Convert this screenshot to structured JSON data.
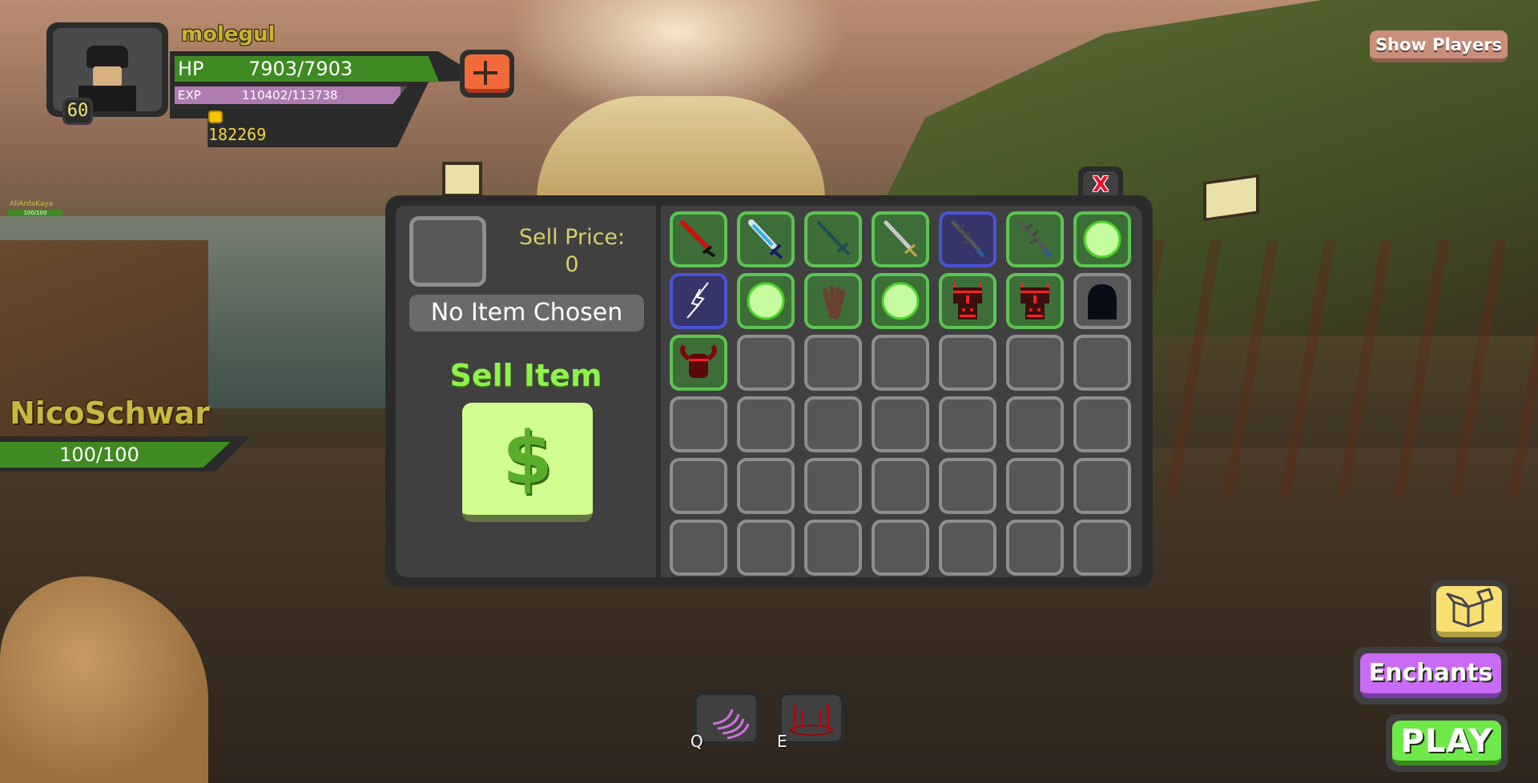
{
  "player": {
    "username": "molegul",
    "level": "60",
    "hp_label": "HP",
    "hp_text": "7903/7903",
    "hp_fraction": 1.0,
    "exp_label": "EXP",
    "exp_text": "110402/113738",
    "exp_fraction": 0.9707,
    "coins": "182269",
    "add_button_icon": "plus-icon"
  },
  "other_players": [
    {
      "name": "AliArdaKaya",
      "hp_text": "100/100"
    }
  ],
  "npc": {
    "name": "NicoSchwar",
    "hp_text": "100/100"
  },
  "top_right": {
    "show_players_label": "Show Players"
  },
  "sell_panel": {
    "close_label": "X",
    "sell_price_label": "Sell Price:",
    "sell_price_value": "0",
    "selected_item_name": "No Item Chosen",
    "sell_item_label": "Sell Item",
    "sell_button_icon": "dollar-icon",
    "inventory": [
      {
        "icon": "red-sword-icon",
        "rarity": "common"
      },
      {
        "icon": "ice-sword-icon",
        "rarity": "common"
      },
      {
        "icon": "teal-sword-icon",
        "rarity": "common"
      },
      {
        "icon": "silver-sword-icon",
        "rarity": "common"
      },
      {
        "icon": "dark-thorn-sword-icon",
        "rarity": "rare"
      },
      {
        "icon": "dark-thorn-sword-icon",
        "rarity": "common"
      },
      {
        "icon": "green-orb-icon",
        "rarity": "common"
      },
      {
        "icon": "lightning-icon",
        "rarity": "rare"
      },
      {
        "icon": "green-orb-icon",
        "rarity": "common"
      },
      {
        "icon": "wood-bundle-icon",
        "rarity": "common"
      },
      {
        "icon": "green-orb-icon",
        "rarity": "common"
      },
      {
        "icon": "red-armor-icon",
        "rarity": "common"
      },
      {
        "icon": "red-armor-icon",
        "rarity": "common"
      },
      {
        "icon": "dark-hood-icon",
        "rarity": "none"
      },
      {
        "icon": "horned-helmet-icon",
        "rarity": "common"
      },
      {
        "icon": "",
        "rarity": "empty"
      },
      {
        "icon": "",
        "rarity": "empty"
      },
      {
        "icon": "",
        "rarity": "empty"
      },
      {
        "icon": "",
        "rarity": "empty"
      },
      {
        "icon": "",
        "rarity": "empty"
      },
      {
        "icon": "",
        "rarity": "empty"
      },
      {
        "icon": "",
        "rarity": "empty"
      },
      {
        "icon": "",
        "rarity": "empty"
      },
      {
        "icon": "",
        "rarity": "empty"
      },
      {
        "icon": "",
        "rarity": "empty"
      },
      {
        "icon": "",
        "rarity": "empty"
      },
      {
        "icon": "",
        "rarity": "empty"
      },
      {
        "icon": "",
        "rarity": "empty"
      },
      {
        "icon": "",
        "rarity": "empty"
      },
      {
        "icon": "",
        "rarity": "empty"
      },
      {
        "icon": "",
        "rarity": "empty"
      },
      {
        "icon": "",
        "rarity": "empty"
      },
      {
        "icon": "",
        "rarity": "empty"
      },
      {
        "icon": "",
        "rarity": "empty"
      },
      {
        "icon": "",
        "rarity": "empty"
      },
      {
        "icon": "",
        "rarity": "empty"
      },
      {
        "icon": "",
        "rarity": "empty"
      },
      {
        "icon": "",
        "rarity": "empty"
      },
      {
        "icon": "",
        "rarity": "empty"
      },
      {
        "icon": "",
        "rarity": "empty"
      },
      {
        "icon": "",
        "rarity": "empty"
      },
      {
        "icon": "",
        "rarity": "empty"
      }
    ]
  },
  "abilities": [
    {
      "key": "Q",
      "icon": "slash-waves-icon"
    },
    {
      "key": "E",
      "icon": "sword-circle-icon"
    }
  ],
  "bottom_right": {
    "box_icon": "open-box-icon",
    "enchants_label": "Enchants",
    "play_label": "PLAY"
  },
  "colors": {
    "hp_green": "#3f8a22",
    "exp_purple": "#b07ab2",
    "common_border": "#5cc452",
    "rare_border": "#4b52d6",
    "empty_border": "#8e8e8e",
    "sell_text": "#d8cf6a",
    "sell_item_green": "#8ff24a"
  }
}
